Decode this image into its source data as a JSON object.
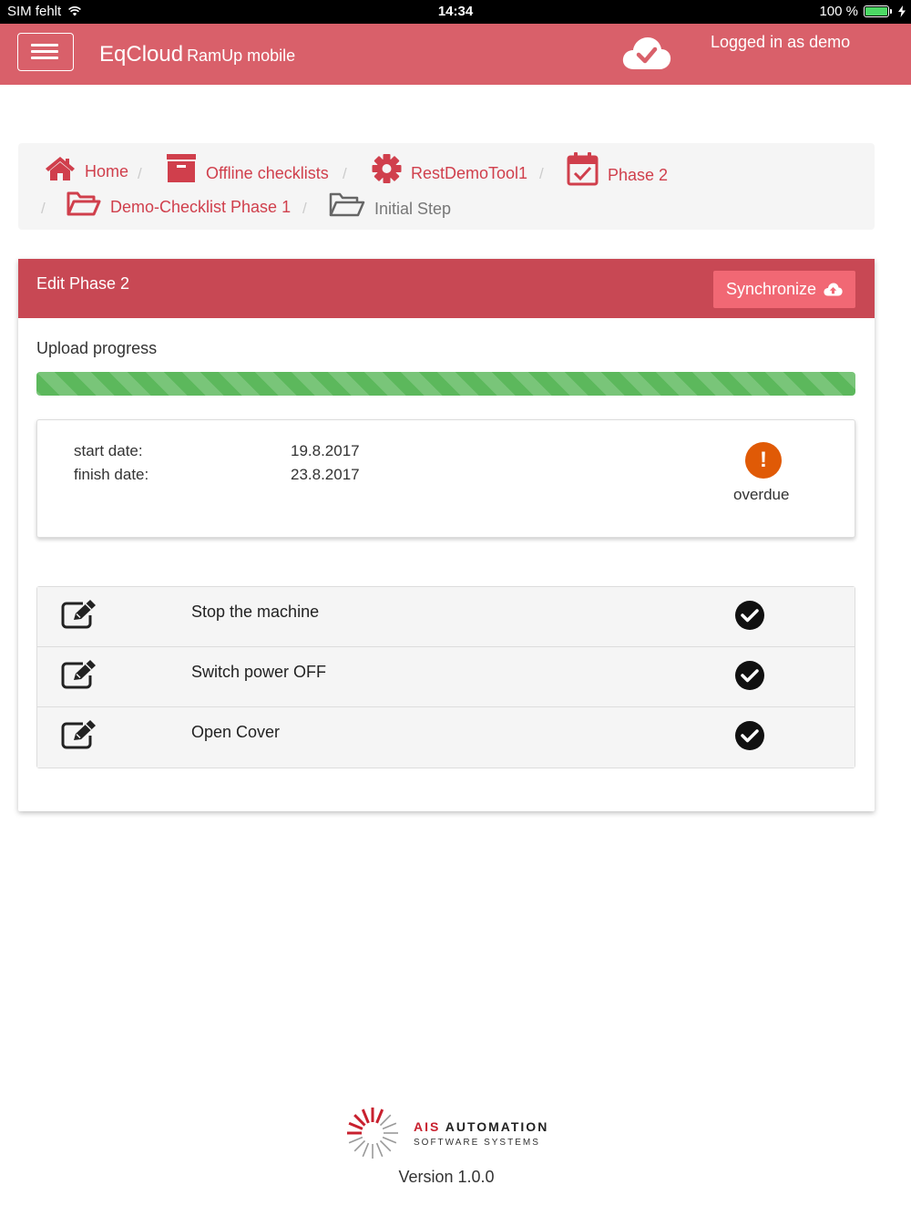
{
  "status_bar": {
    "carrier": "SIM fehlt",
    "time": "14:34",
    "battery": "100 %"
  },
  "navbar": {
    "brand": "EqCloud",
    "brand_sub": "RamUp mobile",
    "login_text": "Logged in as demo",
    "cloud_icon": "cloud-check-icon"
  },
  "breadcrumb": {
    "items": [
      {
        "label": "Home",
        "icon": "home-icon"
      },
      {
        "label": "Offline checklists",
        "icon": "archive-icon"
      },
      {
        "label": "RestDemoTool1",
        "icon": "gear-icon"
      },
      {
        "label": "Phase 2",
        "icon": "calendar-check-icon"
      },
      {
        "label": "Demo-Checklist Phase 1",
        "icon": "folder-open-icon"
      },
      {
        "label": "Initial Step",
        "icon": "folder-open-icon"
      }
    ],
    "separator": "/"
  },
  "panel": {
    "title": "Edit Phase 2",
    "sync_label": "Synchronize",
    "upload_label": "Upload progress",
    "upload_progress": 1.0,
    "start_label": "start date:",
    "start_value": "19.8.2017",
    "finish_label": "finish date:",
    "finish_value": "23.8.2017",
    "status_text": "overdue",
    "status_color": "#e05a06"
  },
  "tasks": [
    {
      "name": "Stop the machine",
      "done": true
    },
    {
      "name": "Switch power OFF",
      "done": true
    },
    {
      "name": "Open Cover",
      "done": true
    }
  ],
  "footer": {
    "logo_word1": "AIS",
    "logo_word2": "AUTOMATION",
    "logo_sub": "SOFTWARE SYSTEMS",
    "version": "Version 1.0.0"
  },
  "colors": {
    "navbar": "#d9606a",
    "panel_heading": "#c84854",
    "sync_button": "#f16874",
    "link": "#d03f4c",
    "progress": "#5cb85c"
  }
}
